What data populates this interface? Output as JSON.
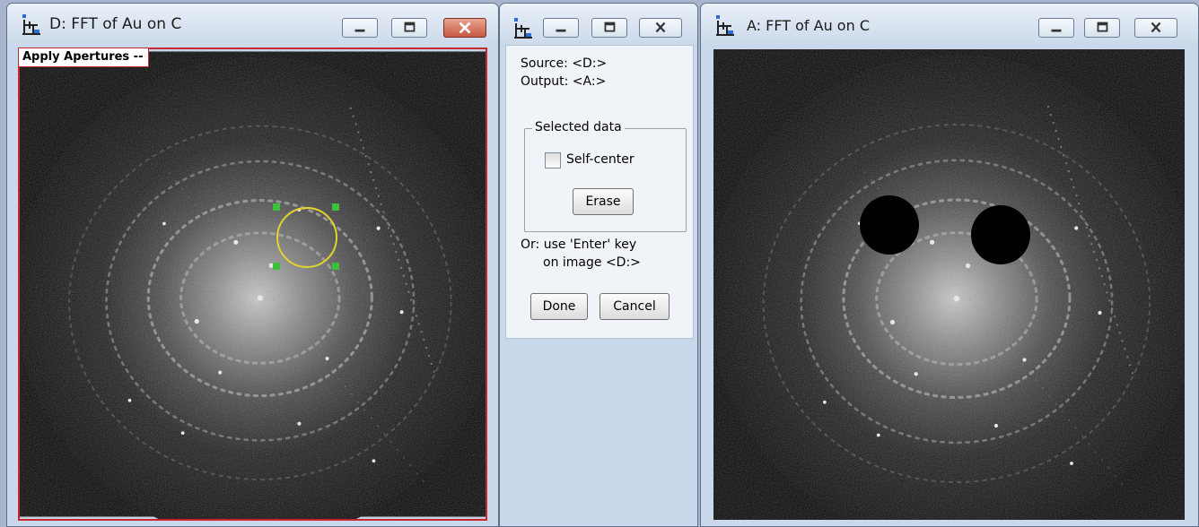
{
  "windows": {
    "left": {
      "title": "D: FFT of Au on C",
      "label": "Apply Apertures --"
    },
    "dialog": {
      "source": "Source: <D:>",
      "output": "Output: <A:>",
      "group_label": "Selected data",
      "checkbox_label": "Self-center",
      "checkbox_checked": false,
      "erase_label": "Erase",
      "hint_line1": "Or: use 'Enter' key",
      "hint_line2": "on image <D:>",
      "done_label": "Done",
      "cancel_label": "Cancel"
    },
    "right": {
      "title": "A: FFT of Au on C"
    }
  },
  "icons": [
    "app-icon",
    "minimize-icon",
    "maximize-icon",
    "close-icon"
  ],
  "colors": {
    "aperture": "#e4d42a",
    "handles": "#3dbf3d",
    "label_border": "#c9272f",
    "close_active": "#c75843"
  }
}
